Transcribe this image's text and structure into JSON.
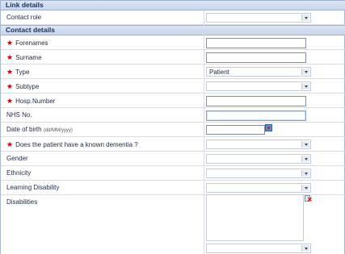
{
  "sections": {
    "link": {
      "title": "Link details"
    },
    "contact": {
      "title": "Contact details"
    }
  },
  "fields": {
    "contact_role": {
      "label": "Contact role",
      "value": ""
    },
    "forenames": {
      "label": "Forenames",
      "required_mark": "★",
      "value": ""
    },
    "surname": {
      "label": "Surname",
      "required_mark": "★",
      "value": ""
    },
    "type": {
      "label": "Type",
      "required_mark": "★",
      "value": "Patient"
    },
    "subtype": {
      "label": "Subtype",
      "required_mark": "★",
      "value": ""
    },
    "hosp_number": {
      "label": "Hosp.Number",
      "required_mark": "★",
      "value": ""
    },
    "nhs_no": {
      "label": "NHS No.",
      "value": ""
    },
    "date_of_birth": {
      "label": "Date of birth",
      "hint": "(dd/MM/yyyy)",
      "value": ""
    },
    "dementia": {
      "label": "Does the patient have a known dementia ?",
      "required_mark": "★",
      "value": ""
    },
    "gender": {
      "label": "Gender",
      "value": ""
    },
    "ethnicity": {
      "label": "Ethnicity",
      "value": ""
    },
    "learning_disability": {
      "label": "Learning Disability",
      "value": ""
    },
    "disabilities": {
      "label": "Disabilities",
      "value": ""
    }
  },
  "icons": {
    "dropdown": "chevron-down-icon",
    "calendar": "calendar-icon",
    "remove": "remove-icon"
  },
  "colors": {
    "header_bg": "#c7d6ec",
    "required": "#cc0000",
    "border": "#7f8fa9"
  }
}
